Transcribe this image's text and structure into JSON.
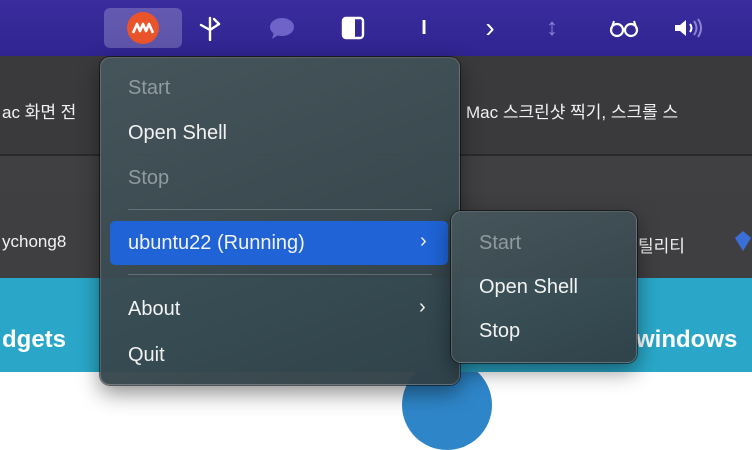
{
  "menubar": {
    "icons": [
      "multipass-icon",
      "pin-icon",
      "chat-bubble-icon",
      "sidebar-icon",
      "bar-icon",
      "chevron-right-icon",
      "vertical-arrows-icon",
      "glasses-icon",
      "speaker-icon"
    ],
    "glasses_glyph": "ⵙ",
    "chevron_glyph": "›",
    "bar_glyph": "I",
    "arrows_glyph": "↕"
  },
  "background": {
    "tab_left": "ac 화면 전",
    "tab_right": "Mac 스크린샷 찍기, 스크롤 스",
    "bookmark_left": "ychong8",
    "bookmark_right": "틸리티",
    "banner_left": "dgets",
    "banner_right": "windows"
  },
  "menu": {
    "start": "Start",
    "open_shell": "Open Shell",
    "stop": "Stop",
    "instance": "ubuntu22 (Running)",
    "about": "About",
    "quit": "Quit",
    "chevron": "›"
  },
  "submenu": {
    "start": "Start",
    "open_shell": "Open Shell",
    "stop": "Stop"
  },
  "colors": {
    "menubar": "#3b2c9e",
    "highlight": "#1f63d6",
    "banner": "#2aa7c8",
    "multipass": "#e9542a"
  }
}
